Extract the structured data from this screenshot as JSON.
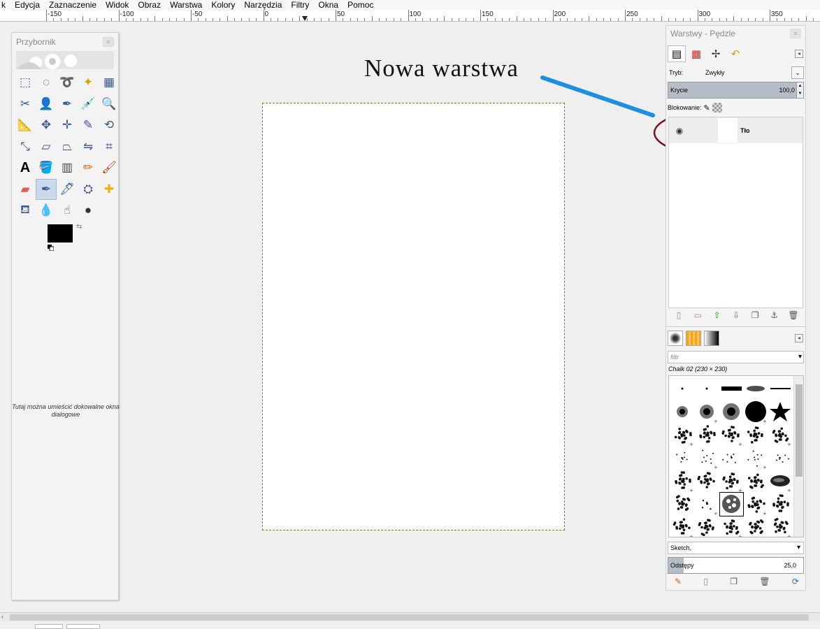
{
  "menubar": {
    "items": [
      "k",
      "Edycja",
      "Zaznaczenie",
      "Widok",
      "Obraz",
      "Warstwa",
      "Kolory",
      "Narzędzia",
      "Filtry",
      "Okna",
      "Pomoc"
    ]
  },
  "ruler": {
    "labels": [
      "-150",
      "-100",
      "-50",
      "0",
      "50",
      "100",
      "150",
      "200",
      "250",
      "300",
      "350"
    ]
  },
  "toolbox": {
    "title": "Przybornik",
    "tools": [
      "rect-select-icon",
      "ellipse-select-icon",
      "free-select-icon",
      "fuzzy-select-icon",
      "color-select-icon",
      "scissors-icon",
      "foreground-select-icon",
      "paths-icon",
      "color-picker-icon",
      "zoom-icon",
      "measure-icon",
      "move-icon",
      "align-icon",
      "crop-icon",
      "rotate-icon",
      "scale-icon",
      "shear-icon",
      "perspective-icon",
      "flip-icon",
      "cage-icon",
      "text-icon",
      "bucket-fill-icon",
      "gradient-icon",
      "pencil-icon",
      "paintbrush-icon",
      "eraser-icon",
      "airbrush-icon",
      "ink-icon",
      "clone-icon",
      "heal-icon",
      "perspective-clone-icon",
      "blur-icon",
      "smudge-icon",
      "dodge-burn-icon"
    ],
    "active_tool_index": 26,
    "foreground_color": "#000000",
    "background_color": "#ffffff",
    "dock_hint": "Tutaj można umieścić dokowalne okna dialogowe"
  },
  "annotation": {
    "text": "Nowa warstwa",
    "arrow_color": "#1b8fe0",
    "ellipse_color": "#7a0f24"
  },
  "canvas": {
    "background": "#ffffff"
  },
  "dock": {
    "title": "Warstwy - Pędzle",
    "layers_tabs": [
      "layers-icon",
      "channels-icon",
      "paths-icon",
      "undo-icon"
    ],
    "mode_label": "Tryb:",
    "mode_value": "Zwykły",
    "opacity_label": "Krycie",
    "opacity_value": "100,0",
    "lock_label": "Blokowanie:",
    "layers": [
      {
        "name": "Tło",
        "visible": true
      }
    ],
    "layer_buttons": [
      "new-layer-icon",
      "new-group-icon",
      "raise-layer-icon",
      "lower-layer-icon",
      "duplicate-layer-icon",
      "anchor-icon",
      "delete-layer-icon"
    ],
    "brush_tabs": [
      "brushes-tab-icon",
      "patterns-tab-icon",
      "gradients-tab-icon"
    ],
    "brush_filter_placeholder": "filtr",
    "brush_name": "Chalk 02 (230 × 230)",
    "selected_brush_index": 27,
    "paint_dynamics": "Sketch,",
    "spacing_label": "Odstępy",
    "spacing_value": "25,0",
    "brush_buttons": [
      "edit-brush-icon",
      "new-brush-icon",
      "duplicate-brush-icon",
      "delete-brush-icon",
      "refresh-brushes-icon"
    ]
  }
}
